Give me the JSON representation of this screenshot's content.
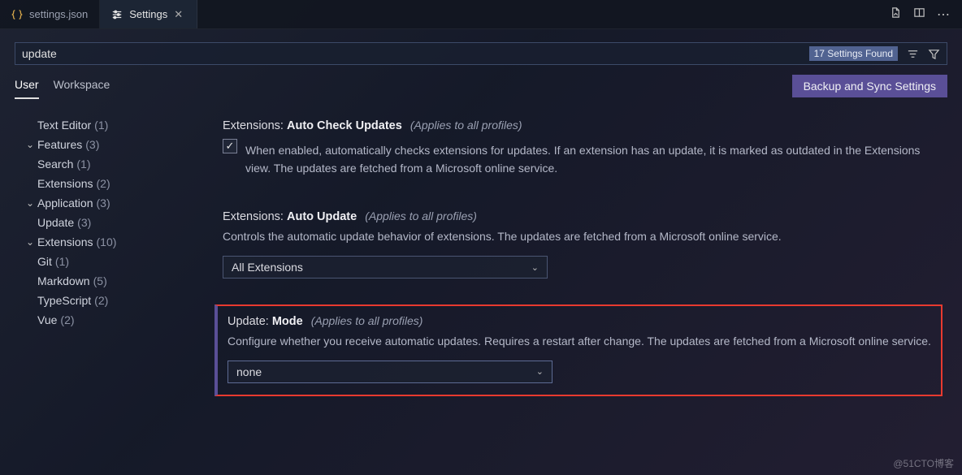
{
  "tabs": [
    {
      "icon": "braces",
      "label": "settings.json",
      "active": false
    },
    {
      "icon": "sliders",
      "label": "Settings",
      "active": true,
      "closable": true
    }
  ],
  "tabbar_actions": [
    "new-file-icon",
    "split-editor-icon",
    "more-icon"
  ],
  "search": {
    "value": "update",
    "found_label": "17 Settings Found"
  },
  "scopes": {
    "items": [
      "User",
      "Workspace"
    ],
    "active": "User",
    "sync_button": "Backup and Sync Settings"
  },
  "toc": [
    {
      "level": 1,
      "label": "Text Editor",
      "count": 1
    },
    {
      "level": 0,
      "label": "Features",
      "count": 3,
      "expanded": true
    },
    {
      "level": 1,
      "label": "Search",
      "count": 1
    },
    {
      "level": 1,
      "label": "Extensions",
      "count": 2
    },
    {
      "level": 0,
      "label": "Application",
      "count": 3,
      "expanded": true
    },
    {
      "level": 1,
      "label": "Update",
      "count": 3
    },
    {
      "level": 0,
      "label": "Extensions",
      "count": 10,
      "expanded": true
    },
    {
      "level": 1,
      "label": "Git",
      "count": 1
    },
    {
      "level": 1,
      "label": "Markdown",
      "count": 5
    },
    {
      "level": 1,
      "label": "TypeScript",
      "count": 2
    },
    {
      "level": 1,
      "label": "Vue",
      "count": 2
    }
  ],
  "settings": [
    {
      "category": "Extensions:",
      "name": "Auto Check Updates",
      "note": "(Applies to all profiles)",
      "type": "checkbox",
      "checked": true,
      "desc": "When enabled, automatically checks extensions for updates. If an extension has an update, it is marked as outdated in the Extensions view. The updates are fetched from a Microsoft online service."
    },
    {
      "category": "Extensions:",
      "name": "Auto Update",
      "note": "(Applies to all profiles)",
      "type": "select",
      "value": "All Extensions",
      "desc": "Controls the automatic update behavior of extensions. The updates are fetched from a Microsoft online service."
    },
    {
      "category": "Update:",
      "name": "Mode",
      "note": "(Applies to all profiles)",
      "type": "select",
      "value": "none",
      "highlight": true,
      "desc": "Configure whether you receive automatic updates. Requires a restart after change. The updates are fetched from a Microsoft online service."
    }
  ],
  "watermark": "@51CTO博客"
}
